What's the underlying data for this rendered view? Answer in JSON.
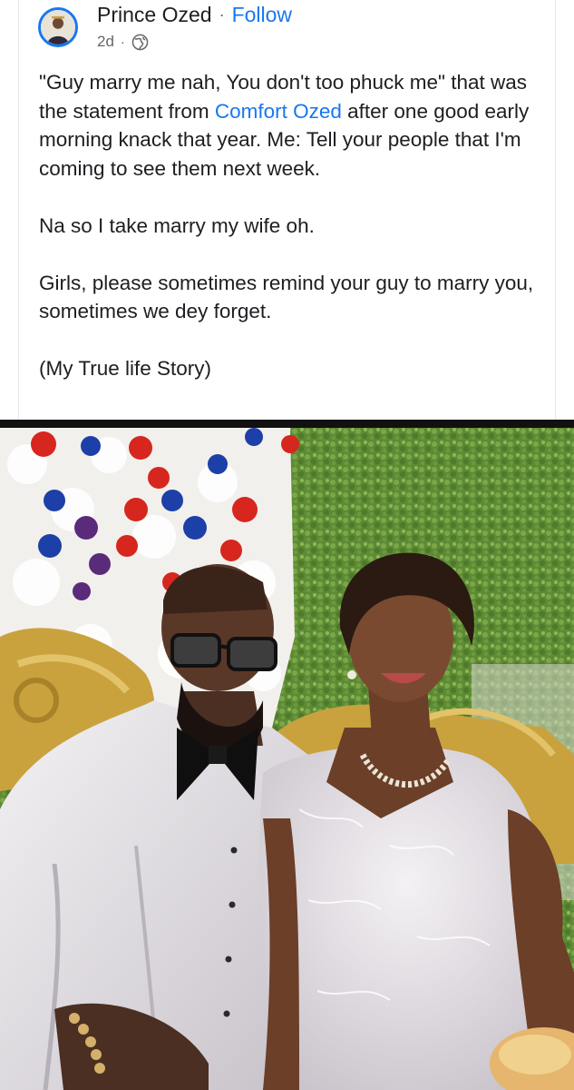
{
  "post": {
    "author": "Prince Ozed",
    "separator": "·",
    "follow_label": "Follow",
    "time": "2d",
    "meta_dot": "·",
    "privacy_icon": "globe-icon",
    "text": {
      "p1_a": "\"Guy marry me nah, You don't too phuck me\" that was the statement from ",
      "mention": "Comfort Ozed",
      "p1_b": " after one good early morning knack that year. Me: Tell your people that I'm coming to see them next week.",
      "p2": "Na so I take marry my wife oh.",
      "p3": "Girls, please sometimes remind your guy to marry you, sometimes we dey forget.",
      "p4": "(My True life Story)"
    }
  },
  "photo": {
    "subject": "couple-wedding-photo"
  },
  "colors": {
    "accent": "#1877f2",
    "text": "#1c1e21",
    "secondary": "#65676b"
  }
}
